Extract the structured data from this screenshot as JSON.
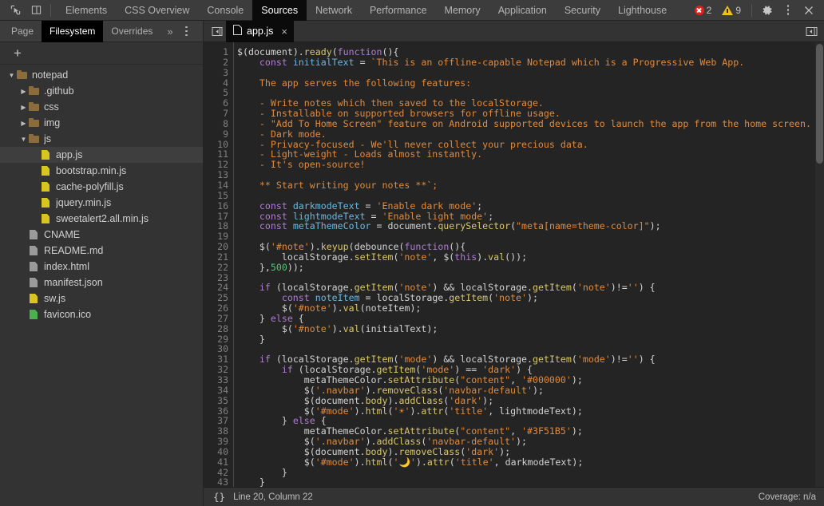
{
  "toolbar": {
    "inspect_icon": "inspect-cursor-icon",
    "device_icon": "device-toolbar-icon",
    "panels": [
      {
        "label": "Elements",
        "active": false
      },
      {
        "label": "CSS Overview",
        "active": false
      },
      {
        "label": "Console",
        "active": false
      },
      {
        "label": "Sources",
        "active": true
      },
      {
        "label": "Network",
        "active": false
      },
      {
        "label": "Performance",
        "active": false
      },
      {
        "label": "Memory",
        "active": false
      },
      {
        "label": "Application",
        "active": false
      },
      {
        "label": "Security",
        "active": false
      },
      {
        "label": "Lighthouse",
        "active": false
      }
    ],
    "error_count": "2",
    "warning_count": "9",
    "settings_icon": "gear-icon",
    "more_icon": "more-vertical-icon",
    "close_icon": "close-icon"
  },
  "navigator": {
    "tabs": [
      {
        "label": "Page",
        "active": false
      },
      {
        "label": "Filesystem",
        "active": true
      },
      {
        "label": "Overrides",
        "active": false
      }
    ],
    "more_tabs_label": "»",
    "more_options_icon": "more-vertical-icon",
    "add_folder_label": "+",
    "tree": [
      {
        "label": "notepad",
        "depth": 0,
        "type": "folder",
        "expanded": true,
        "selected": false
      },
      {
        "label": ".github",
        "depth": 1,
        "type": "folder",
        "expanded": false,
        "selected": false
      },
      {
        "label": "css",
        "depth": 1,
        "type": "folder",
        "expanded": false,
        "selected": false
      },
      {
        "label": "img",
        "depth": 1,
        "type": "folder",
        "expanded": false,
        "selected": false
      },
      {
        "label": "js",
        "depth": 1,
        "type": "folder",
        "expanded": true,
        "selected": false
      },
      {
        "label": "app.js",
        "depth": 2,
        "type": "js",
        "selected": true
      },
      {
        "label": "bootstrap.min.js",
        "depth": 2,
        "type": "js",
        "selected": false
      },
      {
        "label": "cache-polyfill.js",
        "depth": 2,
        "type": "js",
        "selected": false
      },
      {
        "label": "jquery.min.js",
        "depth": 2,
        "type": "js",
        "selected": false
      },
      {
        "label": "sweetalert2.all.min.js",
        "depth": 2,
        "type": "js",
        "selected": false
      },
      {
        "label": "CNAME",
        "depth": 1,
        "type": "doc",
        "selected": false
      },
      {
        "label": "README.md",
        "depth": 1,
        "type": "doc",
        "selected": false
      },
      {
        "label": "index.html",
        "depth": 1,
        "type": "doc",
        "selected": false
      },
      {
        "label": "manifest.json",
        "depth": 1,
        "type": "doc",
        "selected": false
      },
      {
        "label": "sw.js",
        "depth": 1,
        "type": "js",
        "selected": false
      },
      {
        "label": "favicon.ico",
        "depth": 1,
        "type": "green",
        "selected": false
      }
    ]
  },
  "editor": {
    "sidebar_toggle_icon": "show-navigator-icon",
    "collapse_icon": "show-debugger-icon",
    "file_icon": "file-icon",
    "tab_name": "app.js",
    "tab_close": "×",
    "first_line": 1,
    "last_line": 43,
    "lines": [
      {
        "n": 1,
        "text": "$(document).ready(function(){"
      },
      {
        "n": 2,
        "text": "    const initialText = `This is an offline-capable Notepad which is a Progressive Web App."
      },
      {
        "n": 3,
        "text": ""
      },
      {
        "n": 4,
        "text": "    The app serves the following features:"
      },
      {
        "n": 5,
        "text": ""
      },
      {
        "n": 6,
        "text": "    - Write notes which then saved to the localStorage."
      },
      {
        "n": 7,
        "text": "    - Installable on supported browsers for offline usage."
      },
      {
        "n": 8,
        "text": "    - \"Add To Home Screen\" feature on Android supported devices to launch the app from the home screen."
      },
      {
        "n": 9,
        "text": "    - Dark mode."
      },
      {
        "n": 10,
        "text": "    - Privacy-focused - We'll never collect your precious data."
      },
      {
        "n": 11,
        "text": "    - Light-weight - Loads almost instantly."
      },
      {
        "n": 12,
        "text": "    - It's open-source!"
      },
      {
        "n": 13,
        "text": ""
      },
      {
        "n": 14,
        "text": "    ** Start writing your notes **`;"
      },
      {
        "n": 15,
        "text": ""
      },
      {
        "n": 16,
        "text": "    const darkmodeText = 'Enable dark mode';"
      },
      {
        "n": 17,
        "text": "    const lightmodeText = 'Enable light mode';"
      },
      {
        "n": 18,
        "text": "    const metaThemeColor = document.querySelector(\"meta[name=theme-color]\");"
      },
      {
        "n": 19,
        "text": ""
      },
      {
        "n": 20,
        "text": "    $('#note').keyup(debounce(function(){"
      },
      {
        "n": 21,
        "text": "        localStorage.setItem('note', $(this).val());"
      },
      {
        "n": 22,
        "text": "    },500));"
      },
      {
        "n": 23,
        "text": ""
      },
      {
        "n": 24,
        "text": "    if (localStorage.getItem('note') && localStorage.getItem('note')!='') {"
      },
      {
        "n": 25,
        "text": "        const noteItem = localStorage.getItem('note');"
      },
      {
        "n": 26,
        "text": "        $('#note').val(noteItem);"
      },
      {
        "n": 27,
        "text": "    } else {"
      },
      {
        "n": 28,
        "text": "        $('#note').val(initialText);"
      },
      {
        "n": 29,
        "text": "    }"
      },
      {
        "n": 30,
        "text": ""
      },
      {
        "n": 31,
        "text": "    if (localStorage.getItem('mode') && localStorage.getItem('mode')!='') {"
      },
      {
        "n": 32,
        "text": "        if (localStorage.getItem('mode') == 'dark') {"
      },
      {
        "n": 33,
        "text": "            metaThemeColor.setAttribute(\"content\", '#000000');"
      },
      {
        "n": 34,
        "text": "            $('.navbar').removeClass('navbar-default');"
      },
      {
        "n": 35,
        "text": "            $(document.body).addClass('dark');"
      },
      {
        "n": 36,
        "text": "            $('#mode').html('☀').attr('title', lightmodeText);"
      },
      {
        "n": 37,
        "text": "        } else {"
      },
      {
        "n": 38,
        "text": "            metaThemeColor.setAttribute(\"content\", '#3F51B5');"
      },
      {
        "n": 39,
        "text": "            $('.navbar').addClass('navbar-default');"
      },
      {
        "n": 40,
        "text": "            $(document.body).removeClass('dark');"
      },
      {
        "n": 41,
        "text": "            $('#mode').html('🌙').attr('title', darkmodeText);"
      },
      {
        "n": 42,
        "text": "        }"
      },
      {
        "n": 43,
        "text": "    }"
      }
    ]
  },
  "status": {
    "format_icon": "{}",
    "position": "Line 20, Column 22",
    "coverage": "Coverage: n/a"
  },
  "colors": {
    "accent_selected_tab": "#000000",
    "error_red": "#e02020",
    "warning_yellow": "#f0c020",
    "js_file_yellow": "#d8c520",
    "folder_brown": "#8a6d3b",
    "ico_green": "#4caf50",
    "toolbar_bg": "#3c3c3c",
    "nav_bg": "#333333",
    "editor_bg": "#242424"
  }
}
